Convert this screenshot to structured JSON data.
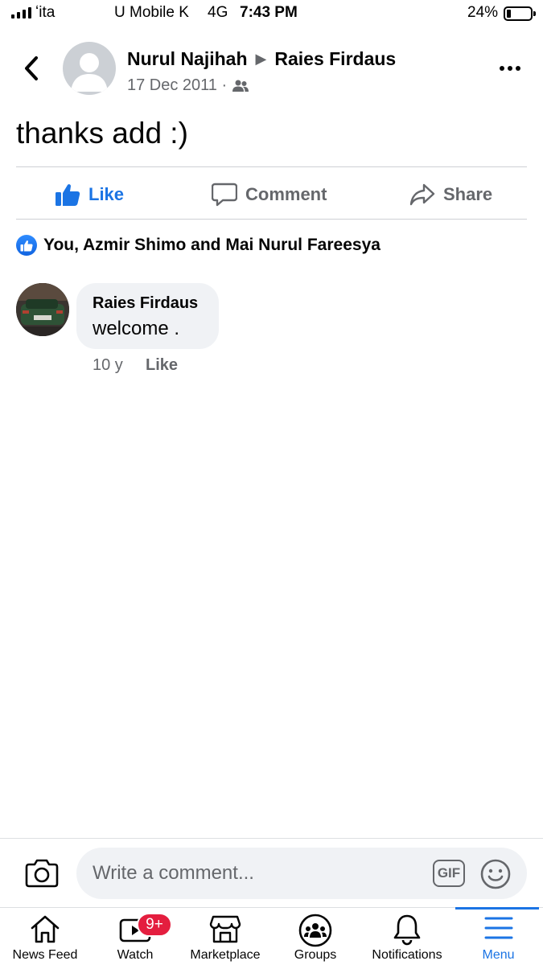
{
  "status_bar": {
    "carrier_1": "ʻita",
    "carrier_2": "U Mobile K",
    "network": "4G",
    "time": "7:43 PM",
    "battery_percent": "24%",
    "battery_level": 0.24,
    "signal_bars": 4
  },
  "post": {
    "author": "Nurul Najihah",
    "target": "Raies Firdaus",
    "date": "17 Dec 2011 ·",
    "audience_icon": "friends-icon",
    "text": "thanks add :)"
  },
  "actions": {
    "like_label": "Like",
    "comment_label": "Comment",
    "share_label": "Share",
    "liked": true
  },
  "reactions": {
    "summary": "You, Azmir Shimo and Mai Nurul Fareesya"
  },
  "comments": [
    {
      "author": "Raies Firdaus",
      "text": "welcome .",
      "time": "10 y",
      "like_label": "Like"
    }
  ],
  "composer": {
    "placeholder": "Write a comment...",
    "gif_label": "GIF"
  },
  "tab_bar": {
    "items": [
      {
        "label": "News Feed",
        "icon": "home-icon"
      },
      {
        "label": "Watch",
        "icon": "video-icon",
        "badge": "9+"
      },
      {
        "label": "Marketplace",
        "icon": "shop-icon"
      },
      {
        "label": "Groups",
        "icon": "groups-icon"
      },
      {
        "label": "Notifications",
        "icon": "bell-icon"
      },
      {
        "label": "Menu",
        "icon": "menu-icon",
        "active": true
      }
    ]
  },
  "colors": {
    "accent": "#1b74e4",
    "secondary_text": "#65676b",
    "bubble_bg": "#f0f2f5",
    "badge_red": "#e41e3f"
  }
}
